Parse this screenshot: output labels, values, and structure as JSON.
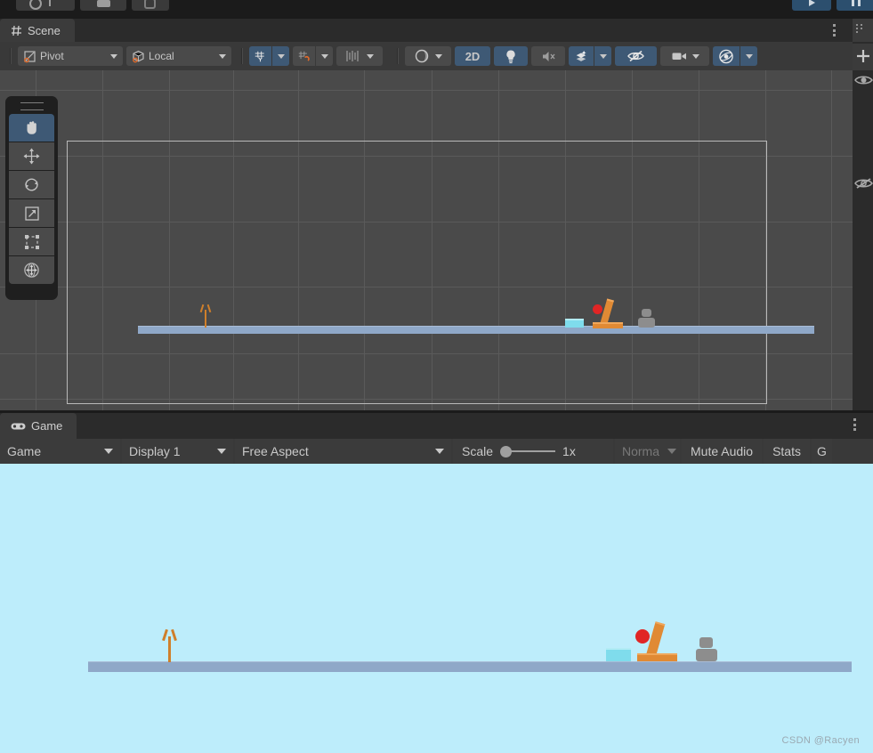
{
  "app": {
    "title": "Unity Editor",
    "theme": "dark",
    "colors": {
      "panel_bg": "#383838",
      "toolbar_bg": "#393939",
      "tab_bg": "#3b3b3b",
      "viewport_bg": "#4a4a4a",
      "accent_blue": "#3e5975",
      "game_sky": "#bdedfb",
      "ground": "#8fa8c8",
      "text": "#c9c9c9"
    }
  },
  "topbar": {
    "buttons": [
      {
        "name": "account-button",
        "icon": "cloud-account-icon",
        "label": ""
      },
      {
        "name": "layers-button",
        "icon": "layers-icon",
        "label": ""
      },
      {
        "name": "layout-button",
        "icon": "layout-icon",
        "label": ""
      }
    ],
    "playback": [
      {
        "name": "play-button",
        "icon": "play-icon",
        "label": ""
      },
      {
        "name": "pause-button",
        "icon": "pause-icon",
        "label": ""
      }
    ]
  },
  "scene_panel": {
    "tab": {
      "label": "Scene",
      "icon": "scene-grid-icon"
    },
    "menu_icon": "kebab-menu-icon",
    "toolbar": {
      "pivot": {
        "label": "Pivot",
        "icon": "pivot-icon",
        "has_caret": true
      },
      "handle_space": {
        "label": "Local",
        "icon": "cube-icon",
        "has_caret": true
      },
      "grid_axis": {
        "label": "",
        "icon": "grid-y-icon",
        "active": true,
        "has_caret": true
      },
      "grid_snap": {
        "label": "",
        "icon": "grid-magnet-icon",
        "active": false,
        "has_caret": true
      },
      "increment_snap": {
        "label": "",
        "icon": "ruler-icon",
        "active": false,
        "has_caret": true
      },
      "shading_mode": {
        "label": "",
        "icon": "shaded-sphere-icon",
        "active": false,
        "has_caret": true
      },
      "two_d": {
        "label": "2D",
        "icon": "",
        "active": true
      },
      "lighting": {
        "label": "",
        "icon": "lightbulb-icon",
        "active": true
      },
      "audio": {
        "label": "",
        "icon": "audio-mute-icon",
        "active": false
      },
      "effects": {
        "label": "",
        "icon": "effects-icon",
        "active": true,
        "has_caret": true
      },
      "hidden_objects": {
        "label": "",
        "icon": "eye-slash-icon",
        "active": true
      },
      "camera_settings": {
        "label": "",
        "icon": "camera-icon",
        "active": false,
        "has_caret": true
      },
      "gizmos": {
        "label": "",
        "icon": "gizmos-globe-icon",
        "active": true,
        "has_caret": true
      }
    },
    "tool_palette": {
      "handle_icon": "drag-handle-icon",
      "tools": [
        {
          "name": "hand-tool",
          "icon": "hand-icon",
          "selected": true
        },
        {
          "name": "move-tool",
          "icon": "move-arrows-icon",
          "selected": false
        },
        {
          "name": "rotate-tool",
          "icon": "rotate-icon",
          "selected": false
        },
        {
          "name": "scale-tool",
          "icon": "scale-icon",
          "selected": false
        },
        {
          "name": "rect-transform-tool",
          "icon": "rect-transform-icon",
          "selected": false
        },
        {
          "name": "transform-tool",
          "icon": "transform-globe-icon",
          "selected": false
        }
      ]
    },
    "scene_objects": [
      {
        "name": "slingshot",
        "type": "slingshot",
        "color": "#cf7f2b"
      },
      {
        "name": "ice-block",
        "type": "box",
        "color": "#7fdcec"
      },
      {
        "name": "red-ball",
        "type": "ball",
        "color": "#e02525"
      },
      {
        "name": "wooden-plank",
        "type": "plank",
        "color": "#e08a34"
      },
      {
        "name": "stone-stack",
        "type": "rock",
        "color": "#8d8d8d"
      }
    ]
  },
  "game_panel": {
    "tab": {
      "label": "Game",
      "icon": "gamepad-icon"
    },
    "menu_icon": "kebab-menu-icon",
    "toolbar": {
      "view_mode": {
        "label": "Game",
        "has_caret": true
      },
      "display": {
        "label": "Display 1",
        "has_caret": true
      },
      "aspect": {
        "label": "Free Aspect",
        "has_caret": true
      },
      "scale": {
        "label": "Scale",
        "value": "1x",
        "slider_position": 0
      },
      "render_mode": {
        "label": "Norma",
        "has_caret": true,
        "dim": true
      },
      "mute_audio": {
        "label": "Mute Audio"
      },
      "stats": {
        "label": "Stats"
      },
      "gizmos": {
        "label": "G"
      }
    },
    "watermark": "CSDN @Racyen"
  },
  "right_strip": {
    "icons": [
      {
        "name": "hierarchy-icon"
      },
      {
        "name": "plus-icon"
      },
      {
        "name": "eye-icon"
      },
      {
        "name": "eye-slash-icon"
      }
    ]
  }
}
